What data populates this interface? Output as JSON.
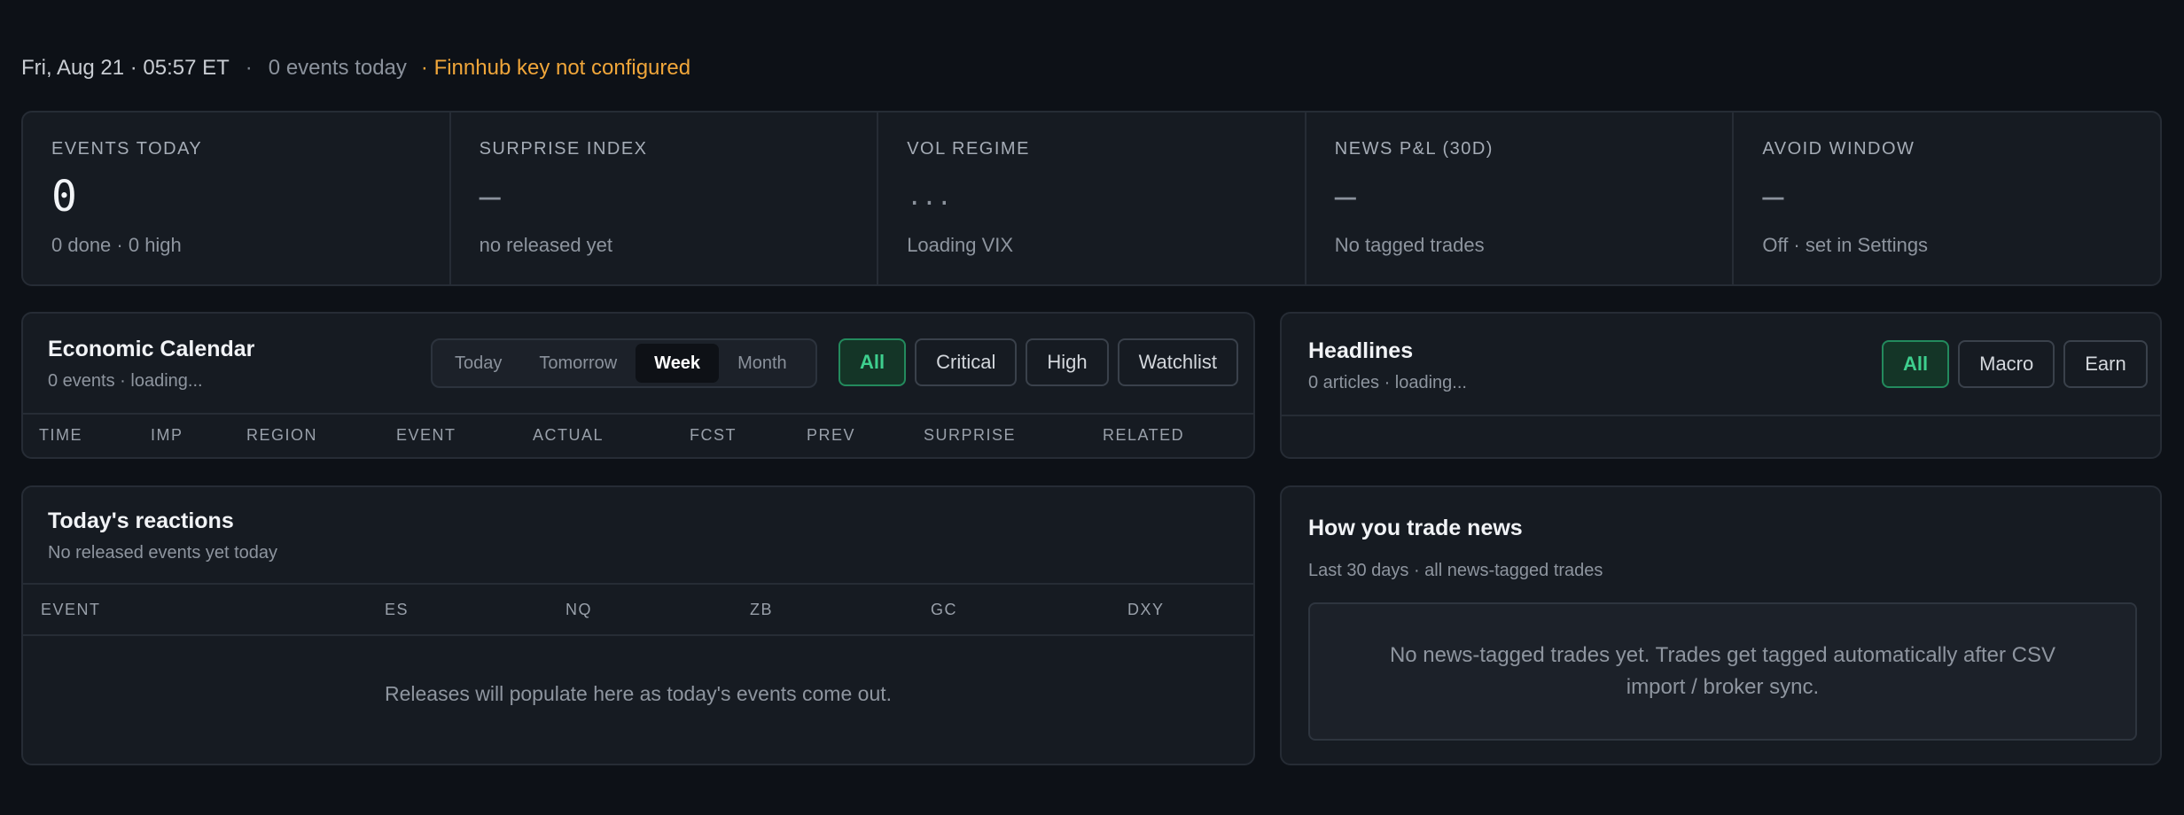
{
  "topbar": {
    "datetime": "Fri, Aug 21 · 05:57 ET",
    "separator": "·",
    "events_today": "0 events today",
    "warning": "· Finnhub key not configured"
  },
  "stats": [
    {
      "label": "EVENTS TODAY",
      "value": "0",
      "sub": "0 done · 0 high"
    },
    {
      "label": "SURPRISE INDEX",
      "value": "—",
      "sub": "no released yet"
    },
    {
      "label": "VOL REGIME",
      "value": "...",
      "sub": "Loading VIX"
    },
    {
      "label": "NEWS P&L (30D)",
      "value": "—",
      "sub": "No tagged trades"
    },
    {
      "label": "AVOID WINDOW",
      "value": "—",
      "sub": "Off · set in Settings"
    }
  ],
  "econ": {
    "title": "Economic Calendar",
    "subtitle": "0 events · loading...",
    "ranges": [
      "Today",
      "Tomorrow",
      "Week",
      "Month"
    ],
    "active_range": "Week",
    "filters": [
      "All",
      "Critical",
      "High",
      "Watchlist"
    ],
    "active_filter": "All",
    "columns": [
      "TIME",
      "IMP",
      "REGION",
      "EVENT",
      "ACTUAL",
      "FCST",
      "PREV",
      "SURPRISE",
      "RELATED"
    ]
  },
  "headlines": {
    "title": "Headlines",
    "subtitle": "0 articles · loading...",
    "filters": [
      "All",
      "Macro",
      "Earn"
    ],
    "active_filter": "All"
  },
  "reactions": {
    "title": "Today's reactions",
    "subtitle": "No released events yet today",
    "columns": [
      "EVENT",
      "ES",
      "NQ",
      "ZB",
      "GC",
      "DXY"
    ],
    "empty": "Releases will populate here as today's events come out."
  },
  "trade": {
    "title": "How you trade news",
    "subtitle": "Last 30 days · all news-tagged trades",
    "empty": "No news-tagged trades yet. Trades get tagged automatically after CSV import / broker sync."
  },
  "colors": {
    "background": "#0d1117",
    "card": "#161b22",
    "accent_green": "#3ecf8e",
    "warning_orange": "#f0a63a"
  }
}
